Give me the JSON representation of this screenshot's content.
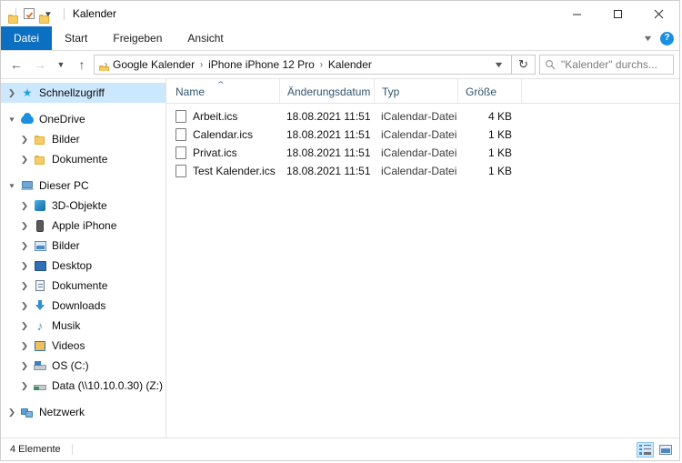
{
  "window": {
    "title": "Kalender",
    "quick_access": [
      {
        "name": "folder-icon"
      },
      {
        "name": "properties-icon"
      },
      {
        "name": "new-folder-icon"
      },
      {
        "name": "customize-caret-icon"
      }
    ],
    "controls": {
      "minimize": "–",
      "maximize": "□",
      "close": "✕"
    }
  },
  "ribbon": {
    "tabs": [
      {
        "label": "Datei",
        "active": true
      },
      {
        "label": "Start",
        "active": false
      },
      {
        "label": "Freigeben",
        "active": false
      },
      {
        "label": "Ansicht",
        "active": false
      }
    ],
    "collapse_icon": "⌄",
    "help_label": "?"
  },
  "address_bar": {
    "back_icon": "←",
    "forward_icon": "→",
    "recent_icon": "⌄",
    "up_icon": "↑",
    "breadcrumbs": [
      "Google Kalender",
      "iPhone iPhone 12 Pro",
      "Kalender"
    ],
    "separator": "›",
    "dropdown_icon": "⌄",
    "refresh_icon": "↻",
    "search_placeholder": "\"Kalender\" durchs..."
  },
  "sidebar": {
    "items": [
      {
        "label": "Schnellzugriff",
        "icon": "star-icon",
        "indent": 1,
        "expander": "›",
        "selected": true,
        "gap_before": false
      },
      {
        "label": "OneDrive",
        "icon": "cloud-icon",
        "indent": 1,
        "expander": "⌄",
        "selected": false,
        "gap_before": true
      },
      {
        "label": "Bilder",
        "icon": "folder-icon",
        "indent": 2,
        "expander": "›",
        "selected": false,
        "gap_before": false
      },
      {
        "label": "Dokumente",
        "icon": "folder-icon",
        "indent": 2,
        "expander": "›",
        "selected": false,
        "gap_before": false
      },
      {
        "label": "Dieser PC",
        "icon": "computer-icon",
        "indent": 1,
        "expander": "⌄",
        "selected": false,
        "gap_before": true
      },
      {
        "label": "3D-Objekte",
        "icon": "3d-objects-icon",
        "indent": 2,
        "expander": "›",
        "selected": false,
        "gap_before": false
      },
      {
        "label": "Apple iPhone",
        "icon": "phone-icon",
        "indent": 2,
        "expander": "›",
        "selected": false,
        "gap_before": false
      },
      {
        "label": "Bilder",
        "icon": "pictures-icon",
        "indent": 2,
        "expander": "›",
        "selected": false,
        "gap_before": false
      },
      {
        "label": "Desktop",
        "icon": "desktop-icon",
        "indent": 2,
        "expander": "›",
        "selected": false,
        "gap_before": false
      },
      {
        "label": "Dokumente",
        "icon": "documents-icon",
        "indent": 2,
        "expander": "›",
        "selected": false,
        "gap_before": false
      },
      {
        "label": "Downloads",
        "icon": "downloads-icon",
        "indent": 2,
        "expander": "›",
        "selected": false,
        "gap_before": false
      },
      {
        "label": "Musik",
        "icon": "music-icon",
        "indent": 2,
        "expander": "›",
        "selected": false,
        "gap_before": false
      },
      {
        "label": "Videos",
        "icon": "videos-icon",
        "indent": 2,
        "expander": "›",
        "selected": false,
        "gap_before": false
      },
      {
        "label": "OS (C:)",
        "icon": "drive-icon",
        "indent": 2,
        "expander": "›",
        "selected": false,
        "gap_before": false
      },
      {
        "label": "Data (\\\\10.10.0.30) (Z:)",
        "icon": "network-drive-icon",
        "indent": 2,
        "expander": "›",
        "selected": false,
        "gap_before": false
      },
      {
        "label": "Netzwerk",
        "icon": "network-icon",
        "indent": 1,
        "expander": "›",
        "selected": false,
        "gap_before": true
      }
    ]
  },
  "file_list": {
    "columns": [
      {
        "label": "Name",
        "key": "name"
      },
      {
        "label": "Änderungsdatum",
        "key": "date"
      },
      {
        "label": "Typ",
        "key": "type"
      },
      {
        "label": "Größe",
        "key": "size"
      }
    ],
    "sort_column": "Name",
    "sort_caret": "⌃",
    "rows": [
      {
        "name": "Arbeit.ics",
        "date": "18.08.2021 11:51",
        "type": "iCalendar-Datei",
        "size": "4 KB"
      },
      {
        "name": "Calendar.ics",
        "date": "18.08.2021 11:51",
        "type": "iCalendar-Datei",
        "size": "1 KB"
      },
      {
        "name": "Privat.ics",
        "date": "18.08.2021 11:51",
        "type": "iCalendar-Datei",
        "size": "1 KB"
      },
      {
        "name": "Test Kalender.ics",
        "date": "18.08.2021 11:51",
        "type": "iCalendar-Datei",
        "size": "1 KB"
      }
    ]
  },
  "status_bar": {
    "item_count": "4 Elemente",
    "views": [
      {
        "name": "details-view-button",
        "active": true
      },
      {
        "name": "large-icons-view-button",
        "active": false
      }
    ]
  },
  "colors": {
    "accent": "#0b6fc2",
    "selection": "#cce8ff",
    "header_text": "#33556e",
    "folder_yellow": "#f7cd69"
  }
}
